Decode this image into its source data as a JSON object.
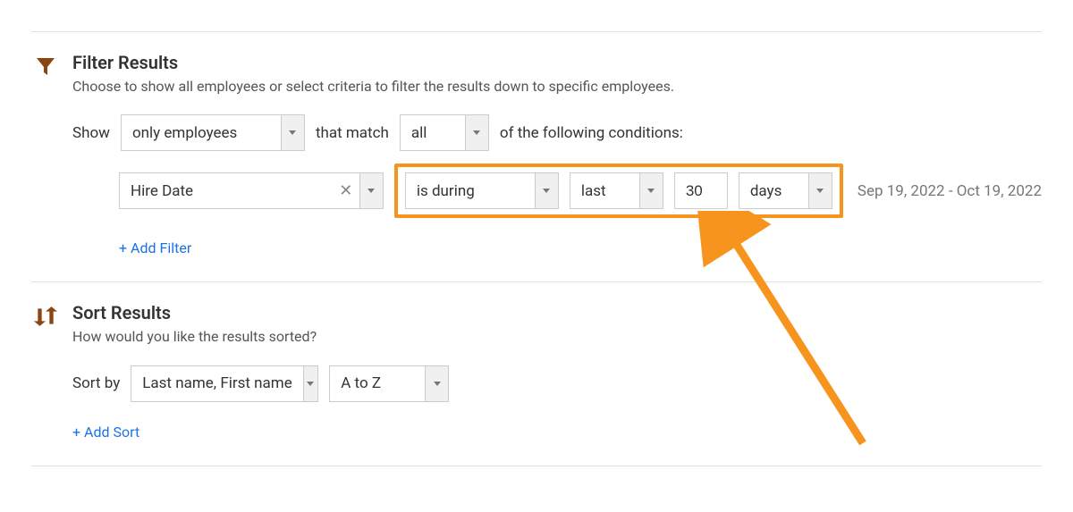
{
  "filter": {
    "title": "Filter Results",
    "description": "Choose to show all employees or select criteria to filter the results down to specific employees.",
    "show_label": "Show",
    "show_select": "only employees",
    "match_label": "that match",
    "match_select": "all",
    "conditions_label": "of the following conditions:",
    "condition": {
      "field": "Hire Date",
      "operator": "is during",
      "range_direction": "last",
      "range_value": "30",
      "range_unit": "days",
      "date_range_text": "Sep 19, 2022 - Oct 19, 2022"
    },
    "add_filter": "+ Add Filter"
  },
  "sort": {
    "title": "Sort Results",
    "description": "How would you like the results sorted?",
    "sort_by_label": "Sort by",
    "sort_field": "Last name, First name",
    "sort_direction": "A to Z",
    "add_sort": "+ Add Sort"
  }
}
